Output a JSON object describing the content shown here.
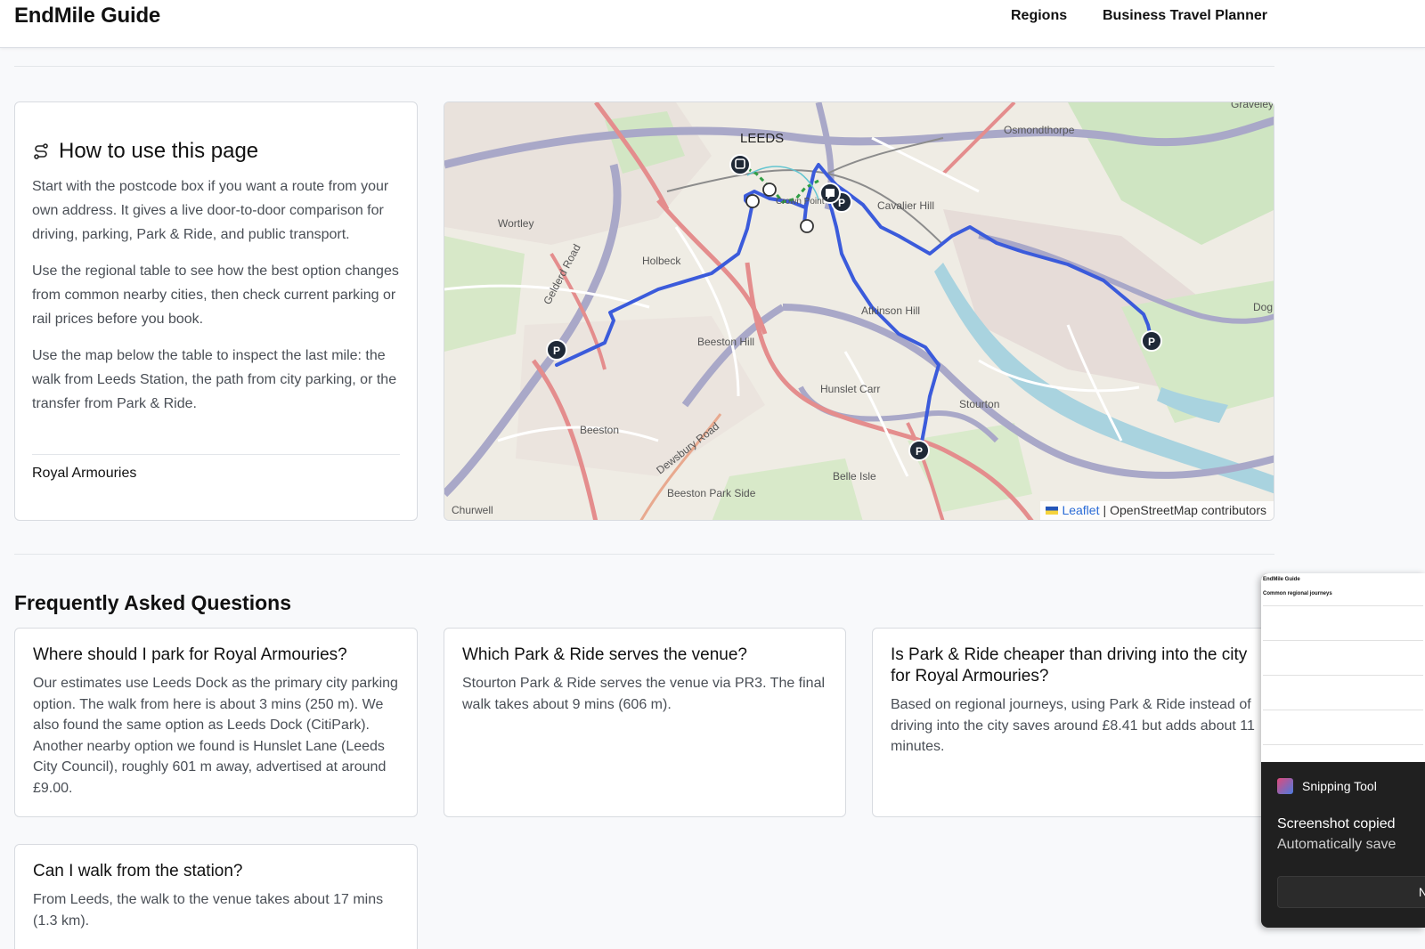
{
  "header": {
    "brand": "EndMile Guide",
    "nav": {
      "regions": "Regions",
      "business_travel_planner": "Business Travel Planner"
    }
  },
  "howto": {
    "title": "How to use this page",
    "paragraphs": [
      "Start with the postcode box if you want a route from your own address. It gives a live door-to-door comparison for driving, parking, Park & Ride, and public transport.",
      "Use the regional table to see how the best option changes from common nearby cities, then check current parking or rail prices before you book.",
      "Use the map below the table to inspect the last mile: the walk from Leeds Station, the path from city parking, or the transfer from Park & Ride."
    ],
    "venue": "Royal Armouries"
  },
  "map": {
    "labels": {
      "leeds": "LEEDS",
      "osmondthorpe": "Osmondthorpe",
      "graveleythorpe": "Graveley",
      "cavalier_hill": "Cavalier Hill",
      "wortley": "Wortley",
      "holbeck": "Holbeck",
      "gelderd_road": "Gelderd Road",
      "beeston_hill": "Beeston Hill",
      "hunslet_carr": "Hunslet Carr",
      "stourton": "Stourton",
      "atkinson": "Atkinson Hill",
      "beeston": "Beeston",
      "dewsbury_road": "Dewsbury Road",
      "belle_isle": "Belle Isle",
      "beeston_park_side": "Beeston Park Side",
      "churwell": "Churwell",
      "crown_point": "Crown Point",
      "dog": "Dog"
    },
    "parking_marker": "P",
    "attribution": {
      "leaflet": "Leaflet",
      "separator": "|",
      "osm": "OpenStreetMap contributors"
    },
    "colors": {
      "route": "#3b5bdb",
      "walk": "#2f9e44",
      "marker": "#1f2937"
    }
  },
  "faq": {
    "heading": "Frequently Asked Questions",
    "items": [
      {
        "q": "Where should I park for Royal Armouries?",
        "a": "Our estimates use Leeds Dock as the primary city parking option. The walk from here is about 3 mins (250 m). We also found the same option as Leeds Dock (CitiPark). Another nearby option we found is Hunslet Lane (Leeds City Council), roughly 601 m away, advertised at around £9.00."
      },
      {
        "q": "Which Park & Ride serves the venue?",
        "a": "Stourton Park & Ride serves the venue via PR3. The final walk takes about 9 mins (606 m)."
      },
      {
        "q": "Is Park & Ride cheaper than driving into the city for Royal Armouries?",
        "a": "Based on regional journeys, using Park & Ride instead of driving into the city saves around £8.41 but adds about 11 minutes."
      },
      {
        "q": "Can I walk from the station?",
        "a": "From Leeds, the walk to the venue takes about 17 mins (1.3 km)."
      }
    ]
  },
  "snipping": {
    "thumb_title": "EndMile Guide",
    "thumb_subtitle": "Common regional journeys",
    "app_name": "Snipping Tool",
    "message": "Screenshot copied",
    "sub": "Automatically save",
    "button": "N"
  }
}
